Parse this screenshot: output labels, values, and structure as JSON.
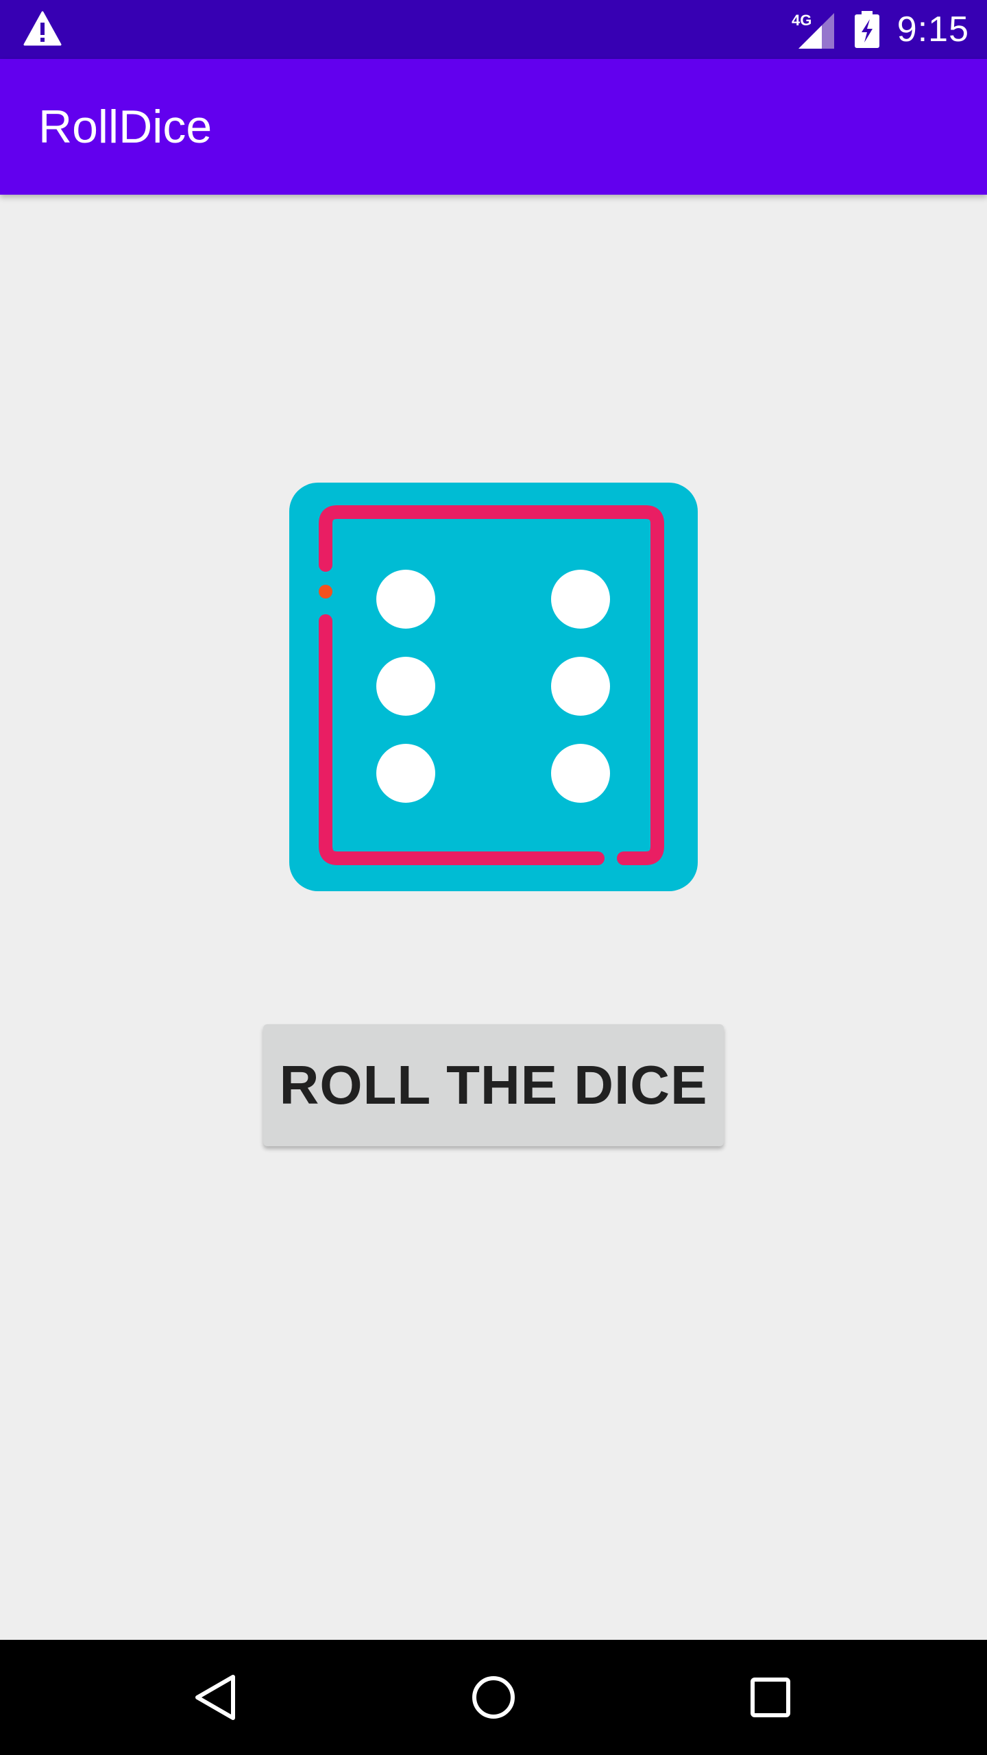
{
  "status_bar": {
    "left_icons": [
      "warning-icon"
    ],
    "right_icons": [
      "signal-4g-icon",
      "battery-charging-icon"
    ],
    "network_label": "4G",
    "time": "9:15"
  },
  "app_bar": {
    "title": "RollDice"
  },
  "dice": {
    "icon": "dice-six-icon",
    "face_value": 6,
    "colors": {
      "face": "#00bcd4",
      "border": "#e91e63",
      "accent_dot": "#f4511e",
      "pips": "#ffffff"
    }
  },
  "roll_button": {
    "label": "ROLL THE DICE"
  },
  "navigation_bar": {
    "buttons": [
      "back-icon",
      "home-icon",
      "recents-icon"
    ]
  },
  "colors": {
    "status_bar": "#3700b3",
    "app_bar": "#6200ee",
    "background": "#eeeeee",
    "button": "#d6d7d7",
    "nav_bar": "#000000"
  }
}
